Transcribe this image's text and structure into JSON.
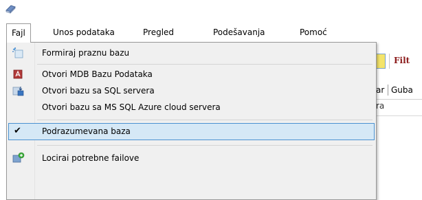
{
  "menubar": {
    "items": [
      {
        "label": "Fajl"
      },
      {
        "label": "Unos podataka"
      },
      {
        "label": "Pregled"
      },
      {
        "label": "Podešavanja"
      },
      {
        "label": "Pomoć"
      }
    ]
  },
  "dropdown": {
    "items": [
      {
        "label": "Formiraj praznu bazu",
        "icon": "new-database-icon"
      },
      {
        "label": "Otvori MDB Bazu Podataka",
        "icon": "access-database-icon"
      },
      {
        "label": "Otvori bazu sa SQL servera",
        "icon": "sql-server-icon"
      },
      {
        "label": "Otvori bazu sa MS SQL Azure cloud servera",
        "icon": ""
      },
      {
        "label": "Podrazumevana baza",
        "checked": true
      },
      {
        "label": "Locirai potrebne failove",
        "icon": "locate-files-icon"
      }
    ]
  },
  "background": {
    "filter_label": "Filt",
    "tabs": [
      "ar",
      "Guba"
    ],
    "row_text": "ra"
  },
  "colors": {
    "highlight": "#d5e8f6",
    "highlight_border": "#4a91d0",
    "filter_text": "#8b1a1a"
  }
}
